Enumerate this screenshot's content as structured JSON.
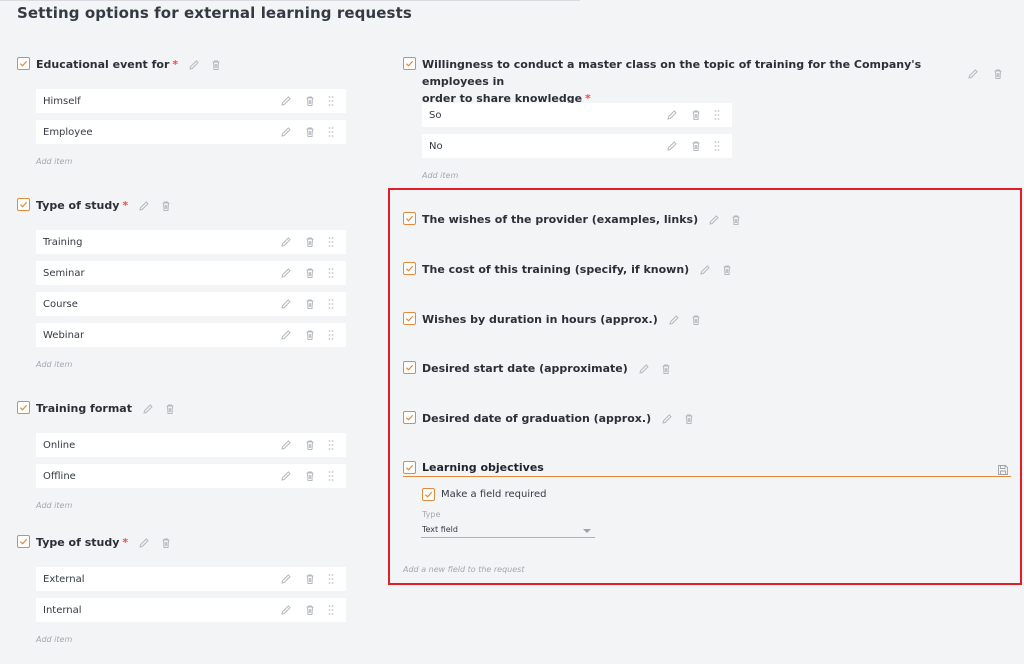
{
  "page": {
    "title": "Setting options for external learning requests"
  },
  "icons": {
    "edit": "pencil-icon",
    "delete": "trash-icon",
    "drag": "drag-handle-icon",
    "save": "save-icon",
    "check": "checkbox-checked-icon"
  },
  "colors": {
    "accent": "#e58a3c",
    "required": "#e5534b",
    "highlight_border": "#e11d2a"
  },
  "add_item_label": "Add item",
  "left_fields": [
    {
      "label": "Educational event for",
      "required": "*",
      "items": [
        "Himself",
        "Employee"
      ]
    },
    {
      "label": "Type of study",
      "required": "*",
      "items": [
        "Training",
        "Seminar",
        "Course",
        "Webinar"
      ]
    },
    {
      "label": "Training format",
      "required": "",
      "items": [
        "Online",
        "Offline"
      ]
    },
    {
      "label": "Type of study",
      "required": "*",
      "items": [
        "External",
        "Internal"
      ]
    }
  ],
  "right_field_master_class": {
    "label_line1": "Willingness to conduct a master class on the topic of training for the Company's employees in",
    "label_line2": "order to share knowledge",
    "required": "*",
    "items": [
      "So",
      "No"
    ]
  },
  "right_fields": [
    {
      "label": "The wishes of the provider (examples, links)"
    },
    {
      "label": "The cost of this training (specify, if known)"
    },
    {
      "label": "Wishes by duration in hours (approx.)"
    },
    {
      "label": "Desired start date (approximate)"
    },
    {
      "label": "Desired date of graduation (approx.)"
    }
  ],
  "editing_field": {
    "value": "Learning objectives",
    "make_required_label": "Make a field required",
    "make_required_checked": true,
    "type_label": "Type",
    "type_value": "Text field"
  },
  "add_field_label": "Add a new field to the request"
}
